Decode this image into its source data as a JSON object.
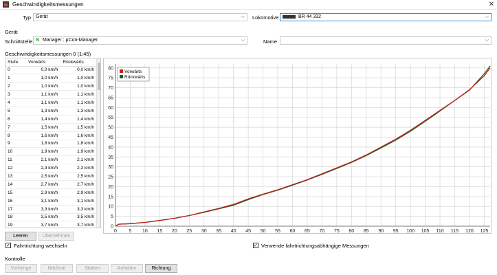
{
  "window": {
    "title": "Geschwindigkeitsmessungen",
    "close_icon": "close-icon"
  },
  "top": {
    "typ_label": "Typ",
    "typ_value": "Gerät",
    "lok_label": "Lokomotive",
    "lok_value": "BR 44 332"
  },
  "geraet": {
    "section_label": "Gerät",
    "schnittstelle_label": "Schnittstelle",
    "schnittstelle_badge": "N",
    "schnittstelle_value": "Manager : µCon-Manager",
    "name_label": "Name",
    "name_value": ""
  },
  "measurements": {
    "section_label": "Geschwindigkeitsmessungen 0 (1:45)",
    "headers": [
      "Stufe",
      "Vorwärts",
      "Rückwärts"
    ],
    "rows": [
      [
        "0",
        "0,0 km/h",
        "0,0 km/h"
      ],
      [
        "1",
        "1,0 km/h",
        "1,0 km/h"
      ],
      [
        "2",
        "1,0 km/h",
        "1,0 km/h"
      ],
      [
        "3",
        "1,1 km/h",
        "1,1 km/h"
      ],
      [
        "4",
        "1,1 km/h",
        "1,1 km/h"
      ],
      [
        "5",
        "1,3 km/h",
        "1,3 km/h"
      ],
      [
        "6",
        "1,4 km/h",
        "1,4 km/h"
      ],
      [
        "7",
        "1,5 km/h",
        "1,5 km/h"
      ],
      [
        "8",
        "1,6 km/h",
        "1,6 km/h"
      ],
      [
        "9",
        "1,8 km/h",
        "1,8 km/h"
      ],
      [
        "10",
        "1,9 km/h",
        "1,9 km/h"
      ],
      [
        "11",
        "2,1 km/h",
        "2,1 km/h"
      ],
      [
        "12",
        "2,3 km/h",
        "2,3 km/h"
      ],
      [
        "13",
        "2,5 km/h",
        "2,5 km/h"
      ],
      [
        "14",
        "2,7 km/h",
        "2,7 km/h"
      ],
      [
        "15",
        "2,9 km/h",
        "2,9 km/h"
      ],
      [
        "16",
        "3,1 km/h",
        "3,1 km/h"
      ],
      [
        "17",
        "3,3 km/h",
        "3,3 km/h"
      ],
      [
        "18",
        "3,5 km/h",
        "3,5 km/h"
      ],
      [
        "19",
        "3,7 km/h",
        "3,7 km/h"
      ]
    ]
  },
  "buttons": {
    "leeren": "Leeren",
    "uebernehmen": "Übernehmen",
    "fahrtrichtung_wechseln": "Fahrtrichtung wechseln",
    "fahrtrichtung_checked": true,
    "richtungsabhaengig": "Verwende fahrtrichtungsabhängige Messungen",
    "richtungsabhaengig_checked": true
  },
  "kontrolle": {
    "section_label": "Kontrolle",
    "vorherige": "Vorherige",
    "naechste": "Nächste",
    "starten": "Starten",
    "anhalten": "Anhalten",
    "richtung": "Richtung"
  },
  "colors": {
    "vorwaerts": "#c0241c",
    "rueckwaerts": "#1e5b2a",
    "accent": "#2a8ad4"
  },
  "chart_data": {
    "type": "line",
    "xlim": [
      0,
      127
    ],
    "ylim": [
      0,
      82
    ],
    "xticks": [
      0,
      5,
      10,
      15,
      20,
      25,
      30,
      35,
      40,
      45,
      50,
      55,
      60,
      65,
      70,
      75,
      80,
      85,
      90,
      95,
      100,
      105,
      110,
      115,
      120,
      125
    ],
    "yticks": [
      0,
      5,
      10,
      15,
      20,
      25,
      30,
      35,
      40,
      45,
      50,
      55,
      60,
      65,
      70,
      75,
      80
    ],
    "grid": true,
    "legend_position": "top-left",
    "series": [
      {
        "name": "Vorwärts",
        "x": [
          0,
          1,
          5,
          10,
          15,
          20,
          25,
          30,
          35,
          40,
          45,
          50,
          55,
          60,
          65,
          70,
          75,
          80,
          85,
          90,
          95,
          100,
          105,
          110,
          115,
          120,
          125,
          127
        ],
        "y": [
          0,
          1,
          1.3,
          1.9,
          2.9,
          4.0,
          5.4,
          7.2,
          9.0,
          11.0,
          13.8,
          16.2,
          18.4,
          21.0,
          23.5,
          26.5,
          29.5,
          32.5,
          36.0,
          40.0,
          44.0,
          48.5,
          53.5,
          58.5,
          63.5,
          69.0,
          76.0,
          80.0
        ]
      },
      {
        "name": "Rückwärts",
        "x": [
          0,
          1,
          5,
          10,
          15,
          20,
          25,
          30,
          35,
          40,
          45,
          50,
          55,
          60,
          65,
          70,
          75,
          80,
          85,
          90,
          95,
          100,
          105,
          110,
          115,
          120,
          125,
          127
        ],
        "y": [
          0,
          1,
          1.3,
          1.9,
          2.9,
          4.0,
          5.4,
          7.0,
          8.8,
          10.6,
          13.4,
          16.0,
          18.2,
          20.7,
          23.3,
          26.2,
          29.2,
          32.2,
          35.7,
          39.5,
          43.5,
          48.0,
          53.0,
          58.2,
          63.5,
          68.8,
          77.0,
          81.0
        ]
      }
    ]
  }
}
